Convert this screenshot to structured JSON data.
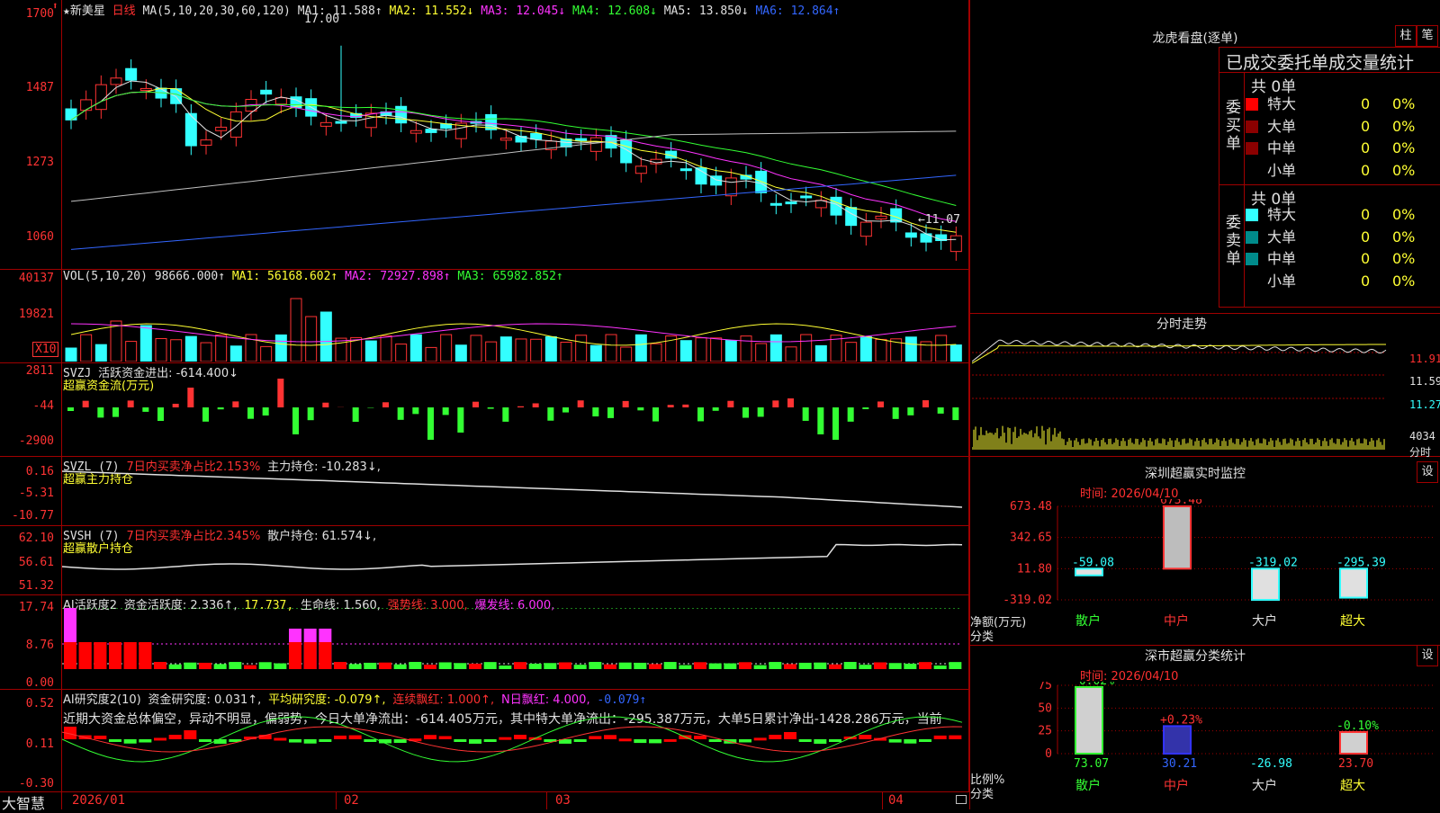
{
  "stock": {
    "name_label": "★新美星",
    "period": "日线"
  },
  "main_panel": {
    "ma_header": "MA(5,10,20,30,60,120)",
    "ma_values": [
      {
        "label": "MA1: 11.588↑",
        "color": "#e0e0e0"
      },
      {
        "label": "MA2: 11.552↓",
        "color": "#ffff33"
      },
      {
        "label": "MA3: 12.045↓",
        "color": "#ff33ff"
      },
      {
        "label": "MA4: 12.608↓",
        "color": "#33ff33"
      },
      {
        "label": "MA5: 13.850↓",
        "color": "#e0e0e0"
      },
      {
        "label": "MA6: 12.864↑",
        "color": "#3366ff"
      }
    ],
    "y_ticks": [
      "1700",
      "1487",
      "1273",
      "1060"
    ],
    "high_mark": "17.00",
    "low_mark": "←11.07"
  },
  "vol_panel": {
    "header": "VOL(5,10,20)",
    "vol": "98666.000↑",
    "ma1": "MA1: 56168.602↑",
    "ma2": "MA2: 72927.898↑",
    "ma3": "MA3: 65982.852↑",
    "y_ticks": [
      "40137",
      "19821"
    ],
    "unit": "X10"
  },
  "svzj_panel": {
    "header": "SVZJ",
    "title": "活跃资金进出: -614.400↓",
    "subtitle": "超赢资金流(万元)",
    "y_ticks": [
      "2811",
      "-44",
      "-2900"
    ]
  },
  "svzl_panel": {
    "header": "SVZL (7)",
    "ratio": "7日内买卖净占比2.153%",
    "hold": "主力持仓: -10.283↓,",
    "subtitle": "超赢主力持仓",
    "y_ticks": [
      "0.16",
      "-5.31",
      "-10.77"
    ]
  },
  "svsh_panel": {
    "header": "SVSH (7)",
    "ratio": "7日内买卖净占比2.345%",
    "hold": "散户持仓: 61.574↓,",
    "subtitle": "超赢散户持仓",
    "y_ticks": [
      "62.10",
      "56.61",
      "51.32"
    ]
  },
  "ai_active_panel": {
    "header": "AI活跃度2",
    "activity": "资金活跃度: 2.336↑,",
    "peak": "17.737,",
    "life": "生命线: 1.560,",
    "strong": "强势线: 3.000,",
    "burst": "爆发线: 6.000,",
    "y_ticks": [
      "17.74",
      "8.76",
      "0.00"
    ]
  },
  "ai_research_panel": {
    "header": "AI研究度2(10)",
    "research": "资金研究度: 0.031↑,",
    "avg": "平均研究度: -0.079↑,",
    "red_series": "连续飘红: 1.000↑,",
    "n_red": "N日飘红: 4.000,",
    "tail": "-0.079↑",
    "summary": "近期大资金总体偏空，异动不明显，偏弱势，今日大单净流出：-614.405万元，其中特大单净流出：-295.387万元，大单5日累计净出-1428.286万元，当前",
    "y_ticks": [
      "0.52",
      "0.11",
      "-0.30"
    ]
  },
  "x_axis": {
    "brand": "大智慧",
    "labels": [
      "2026/01",
      "02",
      "03",
      "04"
    ]
  },
  "dragon_tiger": {
    "title": "龙虎看盘(逐单)",
    "btn1": "柱",
    "btn2": "笔",
    "subtitle": "已成交委托单成交量统计",
    "buy_label": "委买单",
    "sell_label": "委卖单",
    "buy_total": "共 0单",
    "sell_total": "共 0单",
    "buy_rows": [
      {
        "label": "特大",
        "count": "0",
        "pct": "0%",
        "color": "#ff0000"
      },
      {
        "label": "大单",
        "count": "0",
        "pct": "0%",
        "color": "#8b0000"
      },
      {
        "label": "中单",
        "count": "0",
        "pct": "0%",
        "color": "#8b0000"
      },
      {
        "label": "小单",
        "count": "0",
        "pct": "0%",
        "color": "#000000"
      }
    ],
    "sell_rows": [
      {
        "label": "特大",
        "count": "0",
        "pct": "0%",
        "color": "#33ffff"
      },
      {
        "label": "大单",
        "count": "0",
        "pct": "0%",
        "color": "#008b8b"
      },
      {
        "label": "中单",
        "count": "0",
        "pct": "0%",
        "color": "#008b8b"
      },
      {
        "label": "小单",
        "count": "0",
        "pct": "0%",
        "color": "#000000"
      }
    ]
  },
  "intraday": {
    "title": "分时走势",
    "prices": [
      "11.91",
      "11.59",
      "11.27"
    ],
    "vol": "4034",
    "vol_unit": "分时"
  },
  "sz_monitor": {
    "title": "深圳超赢实时监控",
    "btn": "设",
    "time": "时间: 2026/04/10",
    "y_ticks": [
      "673.48",
      "342.65",
      "11.80",
      "-319.02"
    ],
    "ylabel": "净额(万元)",
    "xlabel": "分类",
    "chart_data": {
      "type": "bar",
      "categories": [
        "散户",
        "中户",
        "大户",
        "超大"
      ],
      "values": [
        -59.08,
        673.48,
        -319.02,
        -295.39
      ],
      "ylim": [
        -319.02,
        673.48
      ]
    },
    "value_labels": [
      "-59.08",
      "673.48",
      "-319.02",
      "-295.39"
    ]
  },
  "sz_class": {
    "title": "深市超赢分类统计",
    "btn": "设",
    "time": "时间: 2026/04/10",
    "y_ticks": [
      "75",
      "50",
      "25",
      "0"
    ],
    "ylabel": "比例%",
    "xlabel": "分类",
    "chart_data": {
      "type": "bar",
      "categories": [
        "散户",
        "中户",
        "大户",
        "超大"
      ],
      "values": [
        73.07,
        30.21,
        -26.98,
        23.7
      ],
      "changes": [
        "-0.02%",
        "+0.23%",
        "",
        "-0.10%"
      ],
      "ylim": [
        0,
        75
      ]
    },
    "value_labels": [
      "73.07",
      "30.21",
      "-26.98",
      "23.70"
    ]
  },
  "colors": {
    "up": "#ff3333",
    "down": "#33ffff",
    "border": "#a00000"
  }
}
